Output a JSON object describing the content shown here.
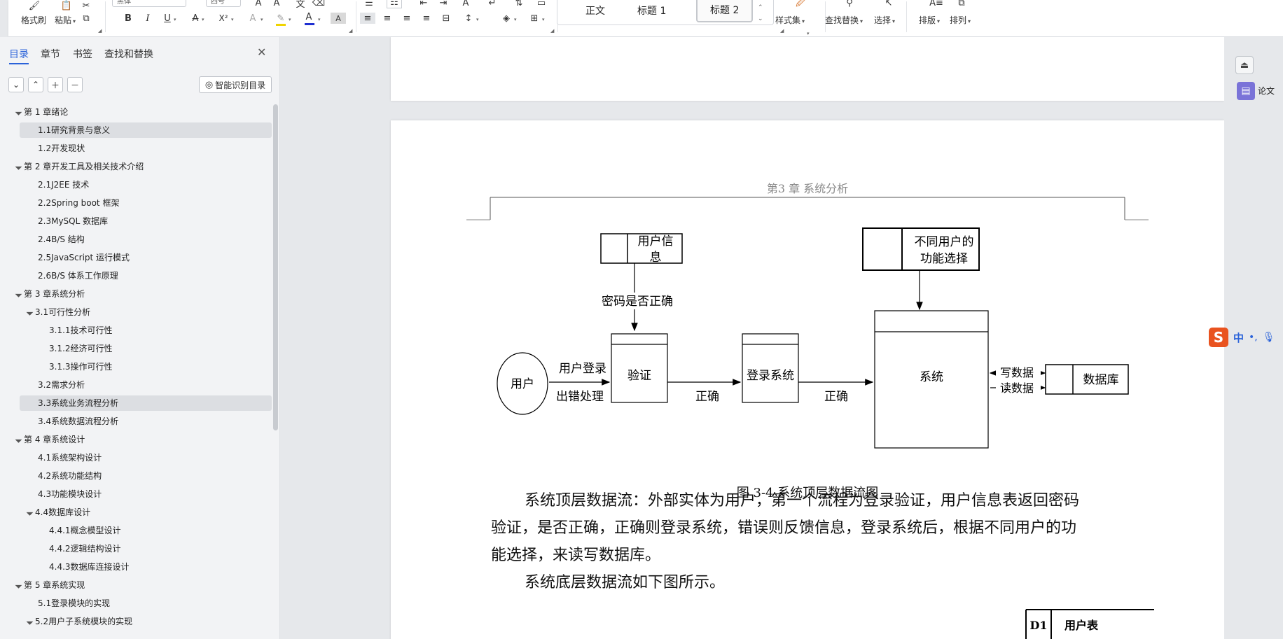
{
  "ribbon": {
    "format_painter": "格式刷",
    "paste": "粘贴",
    "font_name": "黑体",
    "font_size": "四号",
    "styles": {
      "normal": "正文",
      "heading1": "标题 1",
      "heading2": "标题 2"
    },
    "style_set": "样式集",
    "find_replace": "查找替换",
    "select": "选择",
    "layout": "排版",
    "arrange": "排列",
    "font_color": "#1f2fd1",
    "highlight_color": "#f0d400"
  },
  "nav": {
    "tabs": [
      "目录",
      "章节",
      "书签",
      "查找和替换"
    ],
    "smart_button": "智能识别目录",
    "toc": [
      {
        "label": "第 1 章绪论",
        "level": 0,
        "expander": true
      },
      {
        "label": "1.1研究背景与意义",
        "level": 1,
        "selected": true
      },
      {
        "label": "1.2开发现状",
        "level": 1
      },
      {
        "label": "第 2 章开发工具及相关技术介绍",
        "level": 0,
        "expander": true
      },
      {
        "label": "2.1J2EE 技术",
        "level": 1
      },
      {
        "label": "2.2Spring boot 框架",
        "level": 1
      },
      {
        "label": "2.3MySQL 数据库",
        "level": 1
      },
      {
        "label": "2.4B/S 结构",
        "level": 1
      },
      {
        "label": "2.5JavaScript  运行模式",
        "level": 1
      },
      {
        "label": "2.6B/S 体系工作原理",
        "level": 1
      },
      {
        "label": "第 3 章系统分析",
        "level": 0,
        "expander": true
      },
      {
        "label": "3.1可行性分析",
        "level": 1,
        "expander": true
      },
      {
        "label": "3.1.1技术可行性",
        "level": 2
      },
      {
        "label": "3.1.2经济可行性",
        "level": 2
      },
      {
        "label": "3.1.3操作可行性",
        "level": 2
      },
      {
        "label": "3.2需求分析",
        "level": 1
      },
      {
        "label": "3.3系统业务流程分析",
        "level": 1,
        "selected": true
      },
      {
        "label": "3.4系统数据流程分析",
        "level": 1
      },
      {
        "label": "第 4 章系统设计",
        "level": 0,
        "expander": true
      },
      {
        "label": "4.1系统架构设计",
        "level": 1
      },
      {
        "label": "4.2系统功能结构",
        "level": 1
      },
      {
        "label": "4.3功能模块设计",
        "level": 1
      },
      {
        "label": "4.4数据库设计",
        "level": 1,
        "expander": true
      },
      {
        "label": "4.4.1概念模型设计",
        "level": 2
      },
      {
        "label": "4.4.2逻辑结构设计",
        "level": 2
      },
      {
        "label": "4.4.3数据库连接设计",
        "level": 2
      },
      {
        "label": "第 5 章系统实现",
        "level": 0,
        "expander": true
      },
      {
        "label": "5.1登录模块的实现",
        "level": 1
      },
      {
        "label": "5.2用户子系统模块的实现",
        "level": 1,
        "expander": true
      }
    ]
  },
  "doc": {
    "running_header": "第3 章  系统分析",
    "diagram": {
      "store_user_info": "用户信息",
      "store_func_select": "不同用户的功能选择",
      "label_password": "密码是否正确",
      "entity_user": "用户",
      "label_user_login": "用户登录",
      "label_error": "出错处理",
      "process_verify": "验证",
      "label_correct": "正确",
      "process_login": "登录系统",
      "process_system": "系统",
      "label_write": "写数据",
      "label_read": "读数据",
      "store_database": "数据库"
    },
    "caption": "图 3-4 系统顶层数据流图",
    "para_lines": [
      "系统顶层数据流：外部实体为用户，第一个流程为登录验证，用户信息表返回密码",
      "验证，是否正确，正确则登录系统，错误则反馈信息，登录系统后，根据不同用户的功",
      "能选择，来读写数据库。"
    ],
    "para2": "系统底层数据流如下图所示。",
    "next_fig": {
      "id": "D1",
      "name": "用户表"
    }
  },
  "right": {
    "thesis_label": "论文",
    "ime_lang": "中"
  }
}
